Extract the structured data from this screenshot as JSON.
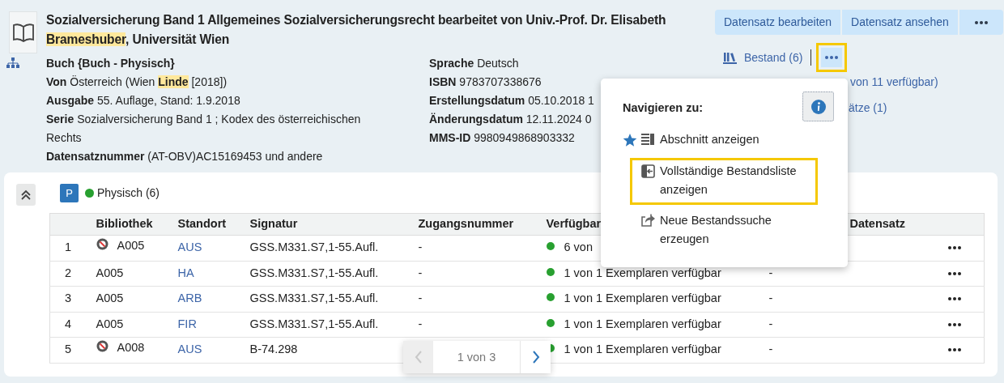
{
  "record": {
    "title": {
      "before": "Sozialversicherung Band 1 Allgemeines Sozialversicherungsrecht bearbeitet von Univ.-Prof. Dr. Elisabeth ",
      "highlight": "Brameshuber",
      "after": ", Universität Wien"
    },
    "actions": [
      {
        "label": "Datensatz bearbeiten",
        "kind": "text"
      },
      {
        "label": "Datensatz ansehen",
        "kind": "text"
      },
      {
        "kind": "more"
      }
    ],
    "fields_left": [
      {
        "label": "Buch {Buch - Physisch}"
      },
      {
        "label": "Von",
        "value": {
          "before": "Österreich (Wien ",
          "highlight": "Linde",
          "after": " [2018])"
        }
      },
      {
        "label": "Ausgabe",
        "value": {
          "before": "55. Auflage, Stand: 1.9.2018"
        }
      },
      {
        "label": "Serie",
        "value": {
          "before": "Sozialversicherung Band 1 ; Kodex des österreichischen Rechts"
        }
      },
      {
        "label": "Datensatznummer",
        "value": {
          "before": "(AT-OBV)AC15169453 und andere"
        }
      }
    ],
    "fields_middle": [
      {
        "label": "Sprache",
        "value": "Deutsch"
      },
      {
        "label": "ISBN",
        "value": "9783707338676"
      },
      {
        "label": "Erstellungsdatum",
        "value": "05.10.2018 1"
      },
      {
        "label": "Änderungsdatum",
        "value": "12.11.2024 0"
      },
      {
        "label": "MMS-ID",
        "value": "9980949868903332"
      }
    ],
    "holdings_link": {
      "label": "Bestand (6)"
    },
    "more_button": {
      "highlighted": true
    },
    "side_links": [
      {
        "label": "von 11 verfügbar)"
      },
      {
        "label": "ätze (1)"
      }
    ]
  },
  "menu": {
    "heading": "Navigieren zu:",
    "items": [
      {
        "label": "Abschnitt anzeigen",
        "kind": "section",
        "starred": true,
        "highlighted": false
      },
      {
        "label": "Vollständige Bestandsliste anzeigen",
        "kind": "enter",
        "starred": false,
        "highlighted": true
      },
      {
        "label": "Neue Bestandssuche erzeugen",
        "kind": "share",
        "starred": false,
        "highlighted": false
      }
    ]
  },
  "holdings": {
    "expanded": true,
    "badge": "P",
    "heading": "Physisch (6)",
    "columns": [
      "Bibliothek",
      "Standort",
      "Signatur",
      "Zugangsnummer",
      "Verfügbar",
      "Datensatz"
    ],
    "rows": [
      {
        "number": "1",
        "restricted": true,
        "library": "A005",
        "location": "AUS",
        "call_number": "GSS.M331.S7,1-55.Aufl.",
        "accession": "-",
        "availability": "6 von"
      },
      {
        "number": "2",
        "restricted": false,
        "library": "A005",
        "location": "HA",
        "call_number": "GSS.M331.S7,1-55.Aufl.",
        "accession": "-",
        "availability": "1 von 1 Exemplaren verfügbar",
        "linked": "-"
      },
      {
        "number": "3",
        "restricted": false,
        "library": "A005",
        "location": "ARB",
        "call_number": "GSS.M331.S7,1-55.Aufl.",
        "accession": "-",
        "availability": "1 von 1 Exemplaren verfügbar",
        "linked": "-"
      },
      {
        "number": "4",
        "restricted": false,
        "library": "A005",
        "location": "FIR",
        "call_number": "GSS.M331.S7,1-55.Aufl.",
        "accession": "-",
        "availability": "1 von 1 Exemplaren verfügbar",
        "linked": "-"
      },
      {
        "number": "5",
        "restricted": true,
        "library": "A008",
        "location": "AUS",
        "call_number": "B-74.298",
        "availability": "1 von 1 Exemplaren verfügbar",
        "linked": "-"
      }
    ]
  },
  "pagination": {
    "label": "1 von 3",
    "prev_disabled": true,
    "next_disabled": false
  }
}
